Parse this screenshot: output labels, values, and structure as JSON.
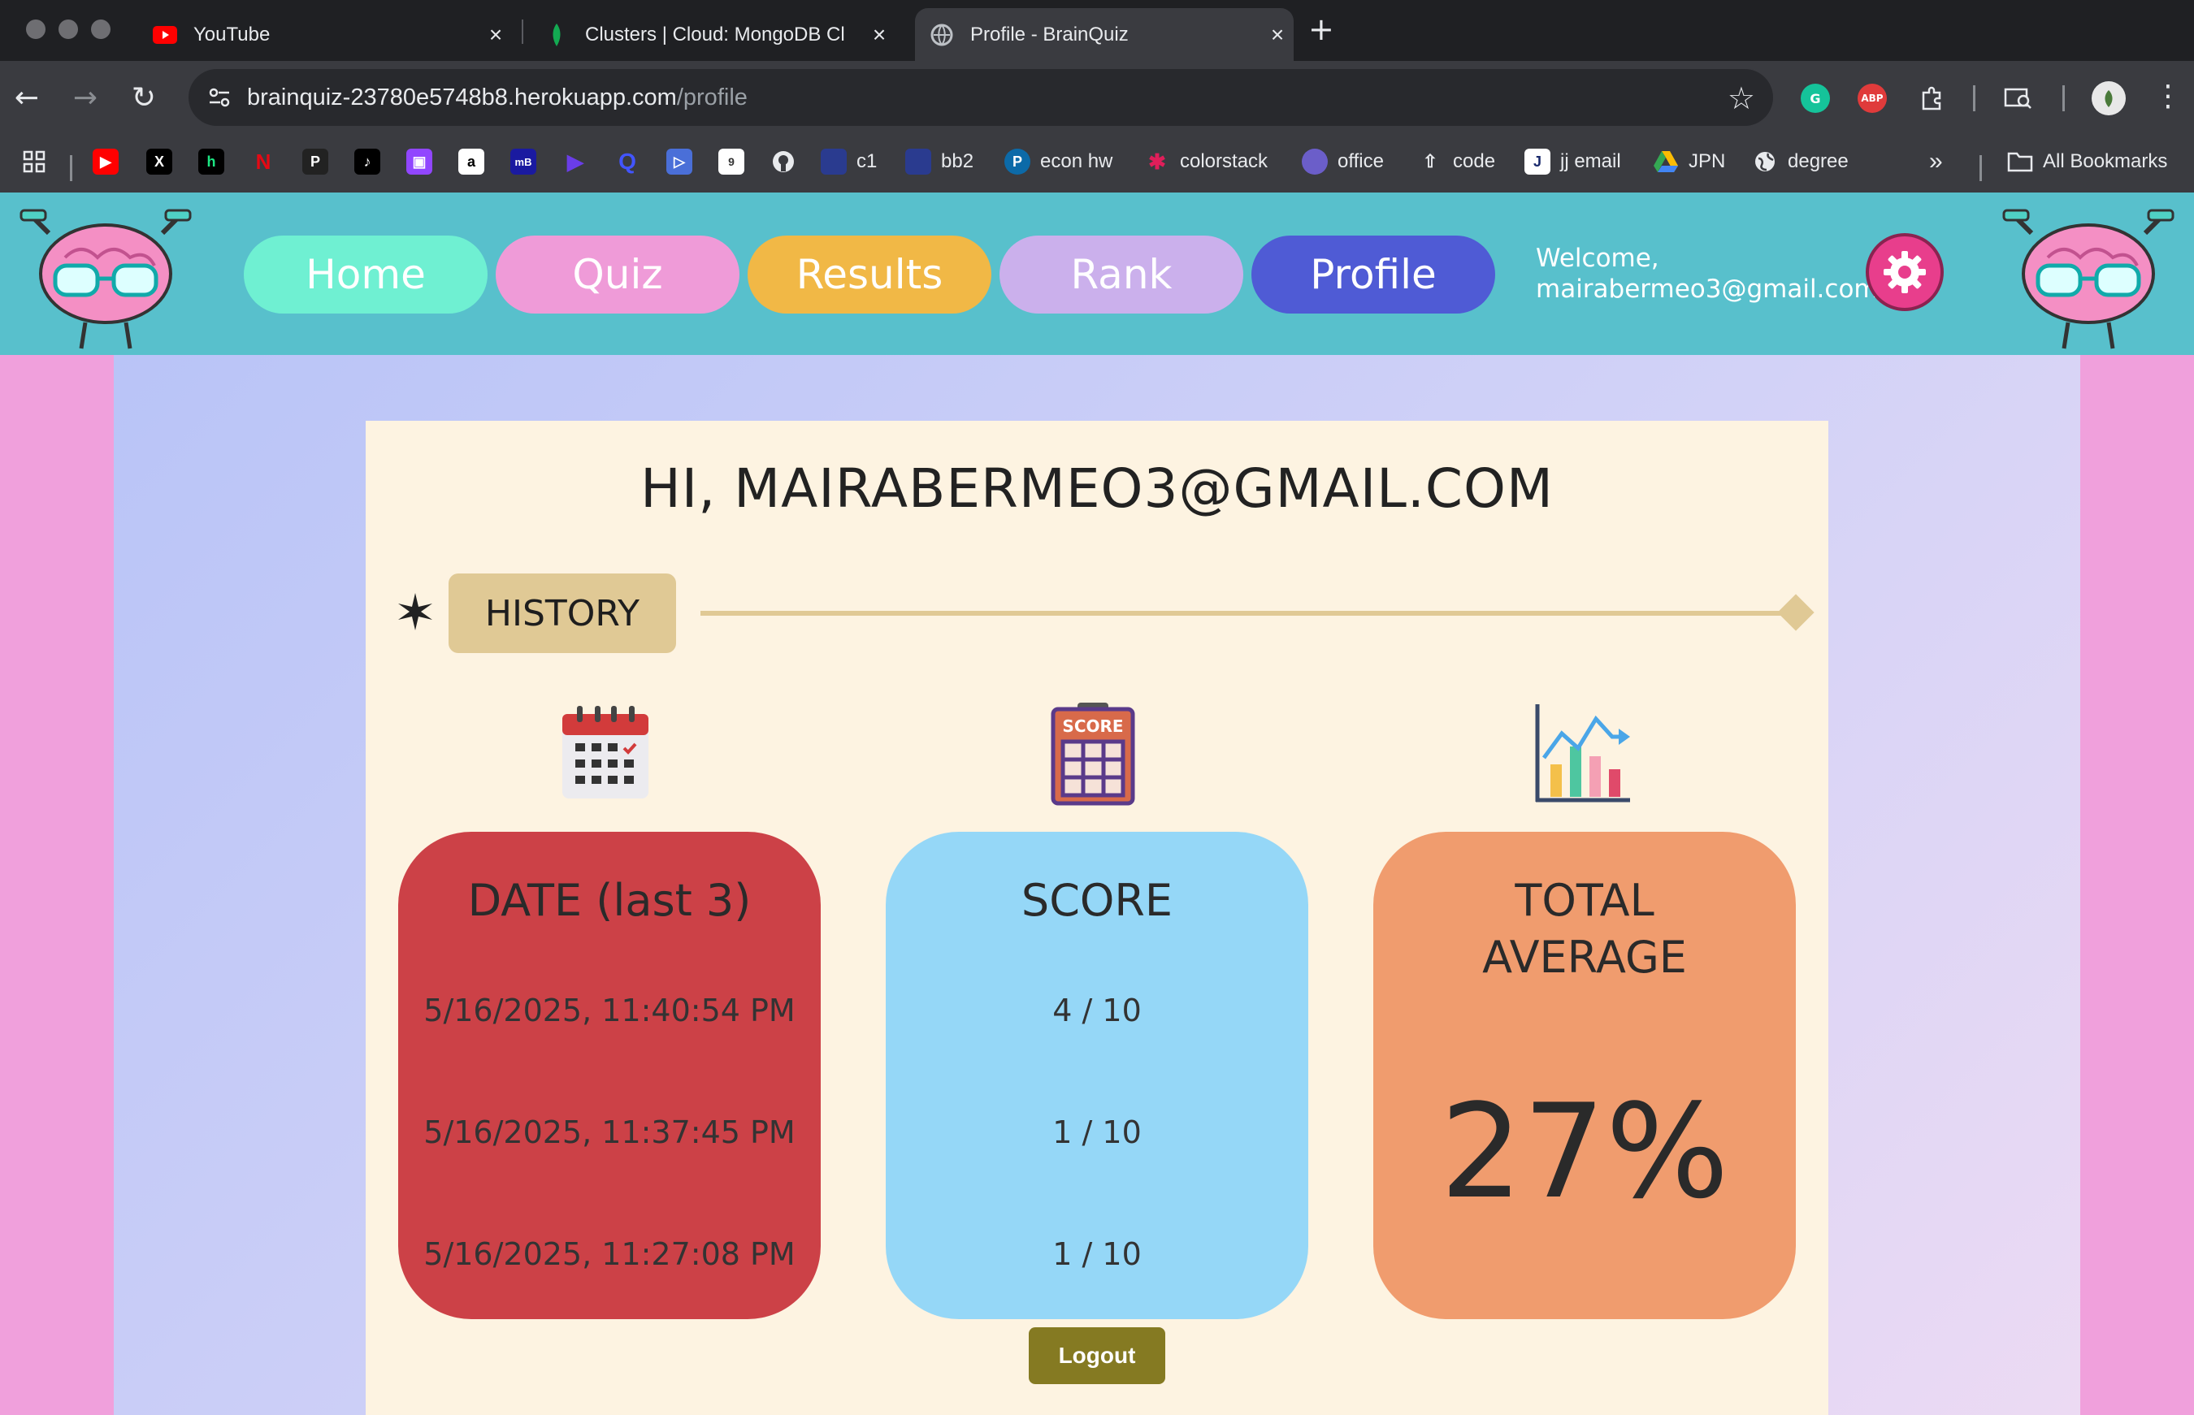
{
  "browser": {
    "tabs": [
      {
        "title": "YouTube",
        "icon": "youtube-icon",
        "active": false
      },
      {
        "title": "Clusters | Cloud: MongoDB Cl",
        "icon": "mongodb-leaf-icon",
        "active": false
      },
      {
        "title": "Profile - BrainQuiz",
        "icon": "globe-icon",
        "active": true
      }
    ],
    "url_host": "brainquiz-23780e5748b8.herokuapp.com",
    "url_path": "/profile",
    "extensions": [
      {
        "name": "grammarly-icon",
        "label": "G",
        "color": "#15c39a"
      },
      {
        "name": "adblock-plus-icon",
        "label": "ABP",
        "color": "#e03b3b"
      },
      {
        "name": "extensions-puzzle-icon",
        "label": "",
        "color": "#3a3b40"
      }
    ],
    "bookmarks": [
      {
        "icon": "apps-grid-icon",
        "label": ""
      },
      {
        "icon": "youtube-icon",
        "label": ""
      },
      {
        "icon": "x-twitter-icon",
        "label": ""
      },
      {
        "icon": "hulu-icon",
        "label": ""
      },
      {
        "icon": "netflix-icon",
        "label": ""
      },
      {
        "icon": "picnic-icon",
        "label": ""
      },
      {
        "icon": "tiktok-icon",
        "label": ""
      },
      {
        "icon": "twitch-icon",
        "label": ""
      },
      {
        "icon": "amazon-icon",
        "label": ""
      },
      {
        "icon": "max-icon",
        "label": ""
      },
      {
        "icon": "play-icon",
        "label": ""
      },
      {
        "icon": "quizlet-icon",
        "label": ""
      },
      {
        "icon": "video-icon",
        "label": ""
      },
      {
        "icon": "doc-icon",
        "label": ""
      },
      {
        "icon": "github-icon",
        "label": ""
      },
      {
        "icon": "c1-icon",
        "label": "c1"
      },
      {
        "icon": "bb2-icon",
        "label": "bb2"
      },
      {
        "icon": "pearson-icon",
        "label": "econ hw"
      },
      {
        "icon": "slack-icon",
        "label": "colorstack"
      },
      {
        "icon": "office-icon",
        "label": "office"
      },
      {
        "icon": "rocket-icon",
        "label": "code"
      },
      {
        "icon": "jj-icon",
        "label": "jj email"
      },
      {
        "icon": "drive-icon",
        "label": "JPN"
      },
      {
        "icon": "globe-icon",
        "label": "degree"
      }
    ],
    "more_bookmarks": "»",
    "all_bookmarks": "All Bookmarks"
  },
  "header": {
    "nav": [
      {
        "label": "Home",
        "color": "#6ff0d2"
      },
      {
        "label": "Quiz",
        "color": "#ef9bd8"
      },
      {
        "label": "Results",
        "color": "#f1b846"
      },
      {
        "label": "Rank",
        "color": "#cbb0ec"
      },
      {
        "label": "Profile",
        "color": "#4f5bd5"
      }
    ],
    "welcome_line1": "Welcome,",
    "welcome_email": "mairabermeo3@gmail.com"
  },
  "profile": {
    "greeting": "HI, MAIRABERMEO3@GMAIL.COM",
    "history_label": "HISTORY",
    "date_box": {
      "title": "DATE (last 3)",
      "rows": [
        "5/16/2025, 11:40:54 PM",
        "5/16/2025, 11:37:45 PM",
        "5/16/2025, 11:27:08 PM"
      ],
      "color": "#cc4147"
    },
    "score_box": {
      "title": "SCORE",
      "rows": [
        "4 / 10",
        "1 / 10",
        "1 / 10"
      ],
      "color": "#95d7f7"
    },
    "avg_box": {
      "title_line1": "TOTAL",
      "title_line2": "AVERAGE",
      "value": "27%",
      "color": "#f09c6e"
    },
    "logout_label": "Logout"
  }
}
